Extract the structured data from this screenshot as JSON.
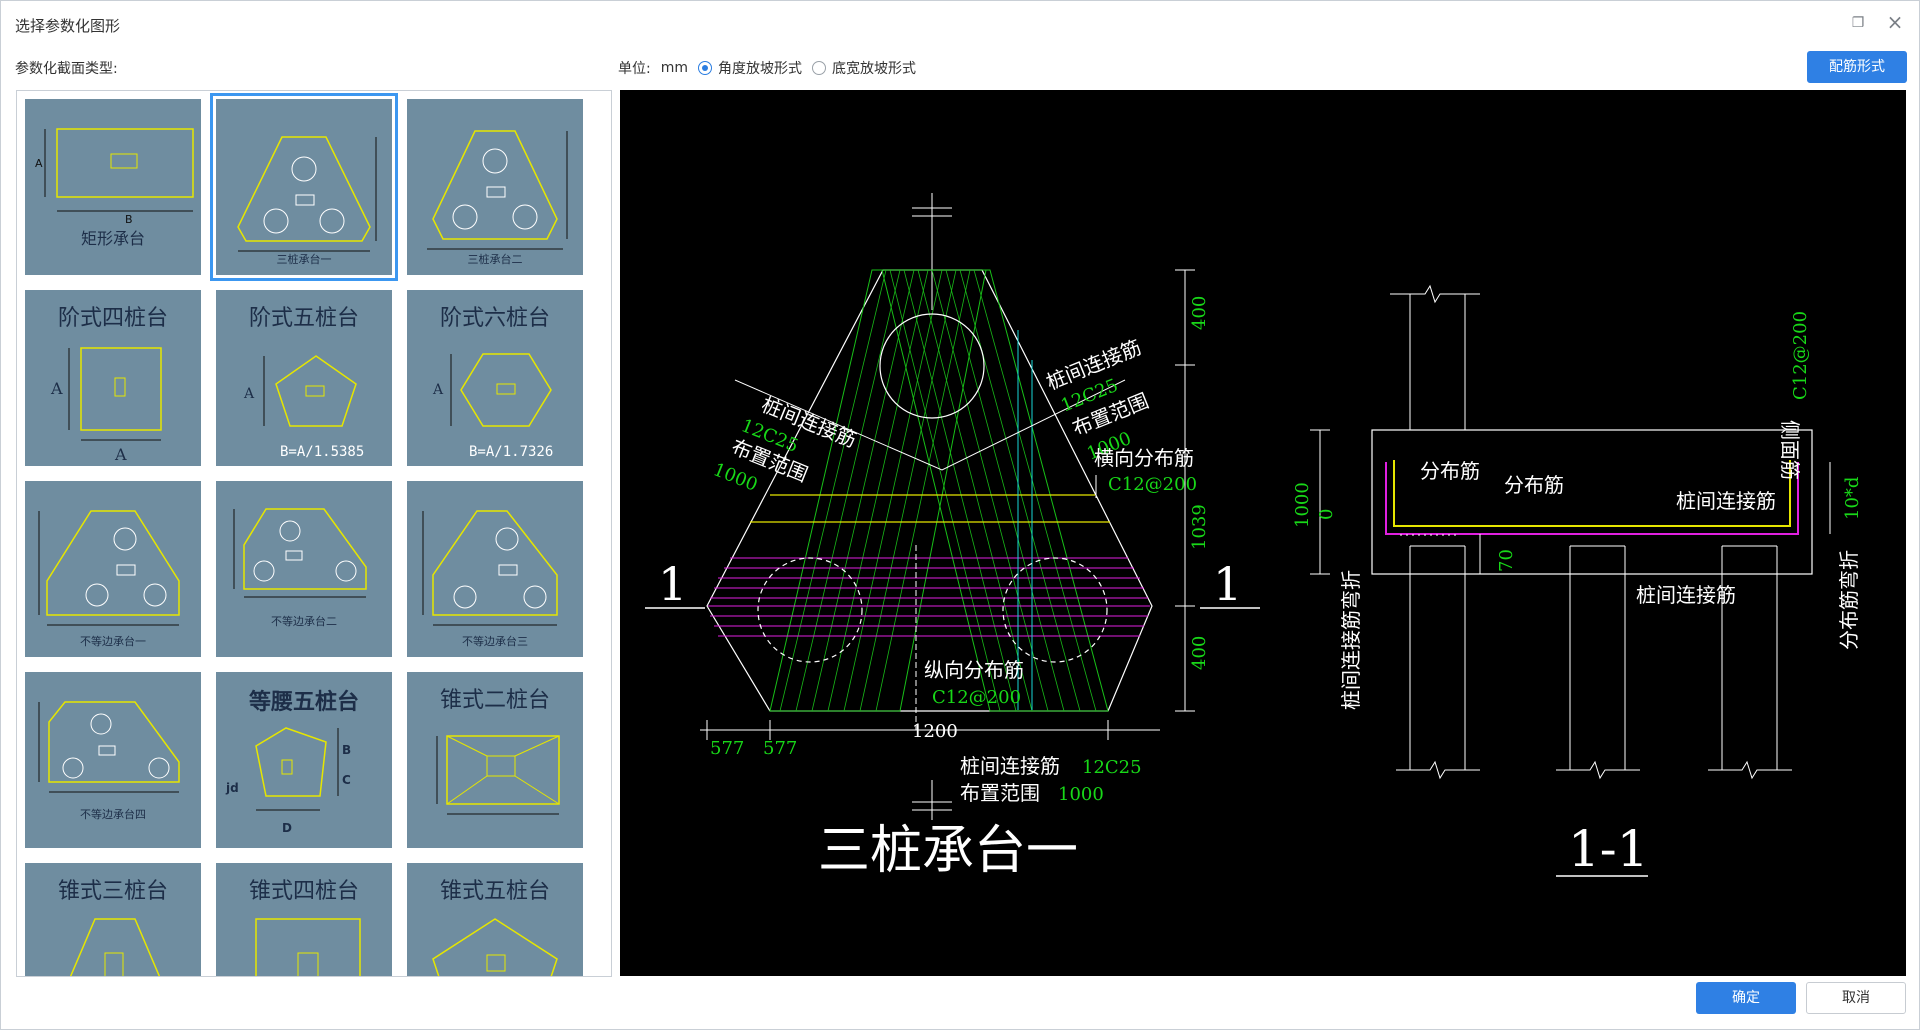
{
  "window": {
    "title": "选择参数化图形"
  },
  "panel": {
    "type_label": "参数化截面类型:"
  },
  "unit": {
    "label": "单位:",
    "value": "mm"
  },
  "radio_options": [
    {
      "label": "角度放坡形式",
      "checked": true
    },
    {
      "label": "底宽放坡形式",
      "checked": false
    }
  ],
  "buttons": {
    "rebar": "配筋形式",
    "ok": "确定",
    "cancel": "取消"
  },
  "thumbnails": [
    {
      "name": "矩形承台",
      "selected": false
    },
    {
      "name": "三桩承台一",
      "selected": true
    },
    {
      "name": "三桩承台二",
      "selected": false
    },
    {
      "name": "阶式四桩台",
      "sub": "A",
      "selected": false
    },
    {
      "name": "阶式五桩台",
      "sub": "B=A/1.5385",
      "selected": false
    },
    {
      "name": "阶式六桩台",
      "sub": "B=A/1.7326",
      "selected": false
    },
    {
      "name": "不等边承台一",
      "selected": false
    },
    {
      "name": "不等边承台二",
      "selected": false
    },
    {
      "name": "不等边承台三",
      "selected": false
    },
    {
      "name": "不等边承台四",
      "selected": false
    },
    {
      "name": "等腰五桩台",
      "selected": false
    },
    {
      "name": "锥式二桩台",
      "selected": false
    },
    {
      "name": "锥式三桩台",
      "selected": false
    },
    {
      "name": "锥式四桩台",
      "selected": false
    },
    {
      "name": "锥式五桩台",
      "selected": false
    }
  ],
  "drawing": {
    "plan_title": "三桩承台一",
    "section_title": "1-1",
    "section_mark": "1",
    "labels": {
      "pile_link_left": "桩间连接筋",
      "pile_link_left_spec": "12C25",
      "range_left": "布置范围",
      "range_left_val": "1000",
      "pile_link_right": "桩间连接筋",
      "pile_link_right_spec": "12C25",
      "range_right": "布置范围",
      "range_right_val": "1000",
      "transverse": "横向分布筋",
      "transverse_spec": "C12@200",
      "longitudinal": "纵向分布筋",
      "longitudinal_spec": "C12@200",
      "bottom_link": "桩间连接筋",
      "bottom_link_spec": "12C25",
      "bottom_range": "布置范围",
      "bottom_range_val": "1000",
      "dim_400_top": "400",
      "dim_1039": "1039",
      "dim_400_bot": "400",
      "dim_577a": "577",
      "dim_577b": "577",
      "dim_1200": "1200",
      "sec_dist1": "分布筋",
      "sec_dist2": "分布筋",
      "sec_link": "桩间连接筋",
      "sec_link2": "桩间连接筋",
      "sec_side": "侧面筋",
      "sec_side_spec": "C12@200",
      "sec_1000": "1000",
      "sec_0": "0",
      "sec_70": "70",
      "sec_10d": "10*d",
      "sec_left_bend": "桩间连接筋弯折",
      "sec_right_bend": "分布筋弯折"
    }
  }
}
